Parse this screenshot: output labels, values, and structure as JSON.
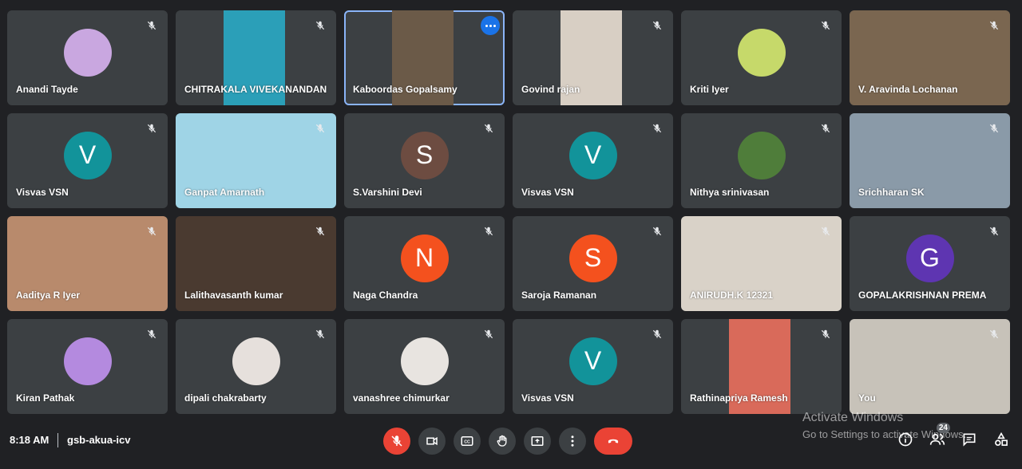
{
  "participants": [
    {
      "name": "Anandi Tayde",
      "kind": "avatar-photo",
      "avatar_bg": "#c9a7e0"
    },
    {
      "name": "CHITRAKALA VIVEKANANDAN",
      "kind": "video",
      "photo_bg": "#2b9fb8"
    },
    {
      "name": "Kaboordas Gopalsamy",
      "kind": "video",
      "photo_bg": "#6b5a48",
      "active": true
    },
    {
      "name": "Govind rajan",
      "kind": "video",
      "photo_bg": "#d8cfc4"
    },
    {
      "name": "Kriti Iyer",
      "kind": "avatar-photo",
      "avatar_bg": "#c6d96a"
    },
    {
      "name": "V. Aravinda Lochanan",
      "kind": "video",
      "photo_bg": "#7a6650"
    },
    {
      "name": "Visvas VSN",
      "kind": "initial",
      "initial": "V",
      "avatar_bg": "#12939a"
    },
    {
      "name": "Ganpat Amarnath",
      "kind": "video",
      "photo_bg": "#9fd4e6"
    },
    {
      "name": "S.Varshini Devi",
      "kind": "initial",
      "initial": "S",
      "avatar_bg": "#6d4c41"
    },
    {
      "name": "Visvas VSN",
      "kind": "initial",
      "initial": "V",
      "avatar_bg": "#12939a"
    },
    {
      "name": "Nithya srinivasan",
      "kind": "avatar-photo",
      "avatar_bg": "#4f7d3a"
    },
    {
      "name": "Srichharan SK",
      "kind": "video",
      "photo_bg": "#8a9aa8"
    },
    {
      "name": "Aaditya R Iyer",
      "kind": "video",
      "photo_bg": "#b88a6c"
    },
    {
      "name": "Lalithavasanth kumar",
      "kind": "video",
      "photo_bg": "#4a3a30"
    },
    {
      "name": "Naga Chandra",
      "kind": "initial",
      "initial": "N",
      "avatar_bg": "#f4511e"
    },
    {
      "name": "Saroja Ramanan",
      "kind": "initial",
      "initial": "S",
      "avatar_bg": "#f4511e"
    },
    {
      "name": "ANIRUDH.K 12321",
      "kind": "video",
      "photo_bg": "#d9d2c8"
    },
    {
      "name": "GOPALAKRISHNAN PREMA",
      "kind": "initial",
      "initial": "G",
      "avatar_bg": "#5e35b1"
    },
    {
      "name": "Kiran Pathak",
      "kind": "avatar-photo",
      "avatar_bg": "#b48adf"
    },
    {
      "name": "dipali chakrabarty",
      "kind": "avatar-photo",
      "avatar_bg": "#e6e0dc"
    },
    {
      "name": "vanashree chimurkar",
      "kind": "avatar-photo",
      "avatar_bg": "#e8e4e0"
    },
    {
      "name": "Visvas VSN",
      "kind": "initial",
      "initial": "V",
      "avatar_bg": "#12939a"
    },
    {
      "name": "Rathinapriya Ramesh",
      "kind": "video",
      "photo_bg": "#d96a5a"
    },
    {
      "name": "You",
      "kind": "video",
      "photo_bg": "#c7c2b9"
    }
  ],
  "meeting": {
    "time": "8:18 AM",
    "code": "gsb-akua-icv"
  },
  "people_count": "24",
  "watermark": {
    "line1": "Activate Windows",
    "line2": "Go to Settings to activate Windows."
  },
  "colors": {
    "bg": "#202124",
    "tile": "#3c4043",
    "end_call": "#ea4335",
    "active_border": "#8ab4f8"
  }
}
